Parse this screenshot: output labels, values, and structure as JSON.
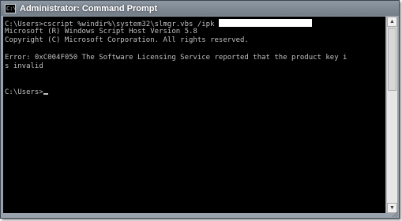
{
  "window": {
    "title": "Administrator: Command Prompt",
    "icon": "cmd-icon",
    "icon_glyph": "C:\\"
  },
  "console": {
    "lines": [
      "C:\\Users>cscript %windir%\\system32\\slmgr.vbs /ipk ",
      "Microsoft (R) Windows Script Host Version 5.8",
      "Copyright (C) Microsoft Corporation. All rights reserved.",
      "",
      "Error: 0xC004F050 The Software Licensing Service reported that the product key i",
      "s invalid",
      "",
      "",
      "C:\\Users>"
    ],
    "background_color": "#000000",
    "text_color": "#c0c0c0"
  },
  "scrollbar": {
    "up_icon": "scroll-up-arrow-icon",
    "down_icon": "scroll-down-arrow-icon"
  }
}
